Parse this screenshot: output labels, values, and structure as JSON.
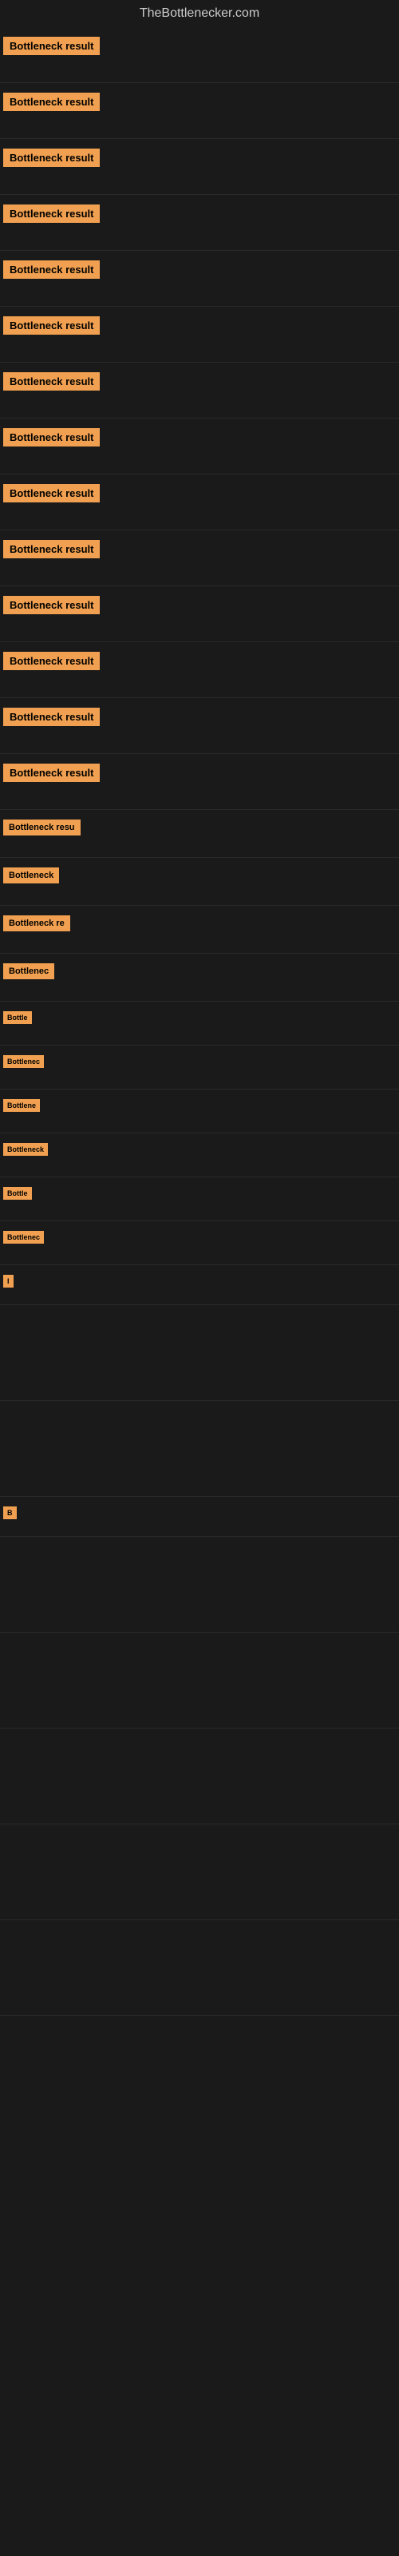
{
  "header": {
    "title": "TheBottlenecker.com"
  },
  "items": [
    {
      "id": 1,
      "label": "Bottleneck result",
      "badgeSize": "normal",
      "height": 70
    },
    {
      "id": 2,
      "label": "Bottleneck result",
      "badgeSize": "normal",
      "height": 70
    },
    {
      "id": 3,
      "label": "Bottleneck result",
      "badgeSize": "normal",
      "height": 70
    },
    {
      "id": 4,
      "label": "Bottleneck result",
      "badgeSize": "normal",
      "height": 70
    },
    {
      "id": 5,
      "label": "Bottleneck result",
      "badgeSize": "normal",
      "height": 70
    },
    {
      "id": 6,
      "label": "Bottleneck result",
      "badgeSize": "normal",
      "height": 70
    },
    {
      "id": 7,
      "label": "Bottleneck result",
      "badgeSize": "normal",
      "height": 70
    },
    {
      "id": 8,
      "label": "Bottleneck result",
      "badgeSize": "normal",
      "height": 70
    },
    {
      "id": 9,
      "label": "Bottleneck result",
      "badgeSize": "normal",
      "height": 70
    },
    {
      "id": 10,
      "label": "Bottleneck result",
      "badgeSize": "normal",
      "height": 70
    },
    {
      "id": 11,
      "label": "Bottleneck result",
      "badgeSize": "normal",
      "height": 70
    },
    {
      "id": 12,
      "label": "Bottleneck result",
      "badgeSize": "normal",
      "height": 70
    },
    {
      "id": 13,
      "label": "Bottleneck result",
      "badgeSize": "normal",
      "height": 70
    },
    {
      "id": 14,
      "label": "Bottleneck result",
      "badgeSize": "normal",
      "height": 70
    },
    {
      "id": 15,
      "label": "Bottleneck resu",
      "badgeSize": "small",
      "height": 60
    },
    {
      "id": 16,
      "label": "Bottleneck",
      "badgeSize": "small",
      "height": 60
    },
    {
      "id": 17,
      "label": "Bottleneck re",
      "badgeSize": "small",
      "height": 60
    },
    {
      "id": 18,
      "label": "Bottlenec",
      "badgeSize": "small",
      "height": 60
    },
    {
      "id": 19,
      "label": "Bottle",
      "badgeSize": "tiny",
      "height": 55
    },
    {
      "id": 20,
      "label": "Bottlenec",
      "badgeSize": "tiny",
      "height": 55
    },
    {
      "id": 21,
      "label": "Bottlene",
      "badgeSize": "tiny",
      "height": 55
    },
    {
      "id": 22,
      "label": "Bottleneck",
      "badgeSize": "tiny",
      "height": 55
    },
    {
      "id": 23,
      "label": "Bottle",
      "badgeSize": "tiny",
      "height": 55
    },
    {
      "id": 24,
      "label": "Bottlenec",
      "badgeSize": "tiny",
      "height": 55
    },
    {
      "id": 25,
      "label": "I",
      "badgeSize": "tiny",
      "height": 50
    },
    {
      "id": 26,
      "label": "",
      "badgeSize": "none",
      "height": 120
    },
    {
      "id": 27,
      "label": "",
      "badgeSize": "none",
      "height": 120
    },
    {
      "id": 28,
      "label": "B",
      "badgeSize": "tiny",
      "height": 50
    },
    {
      "id": 29,
      "label": "",
      "badgeSize": "none",
      "height": 120
    },
    {
      "id": 30,
      "label": "",
      "badgeSize": "none",
      "height": 120
    },
    {
      "id": 31,
      "label": "",
      "badgeSize": "none",
      "height": 120
    },
    {
      "id": 32,
      "label": "",
      "badgeSize": "none",
      "height": 120
    },
    {
      "id": 33,
      "label": "",
      "badgeSize": "none",
      "height": 120
    }
  ],
  "colors": {
    "badge_bg": "#f0a050",
    "badge_text": "#000000",
    "background": "#1a1a1a",
    "title_text": "#cccccc"
  }
}
